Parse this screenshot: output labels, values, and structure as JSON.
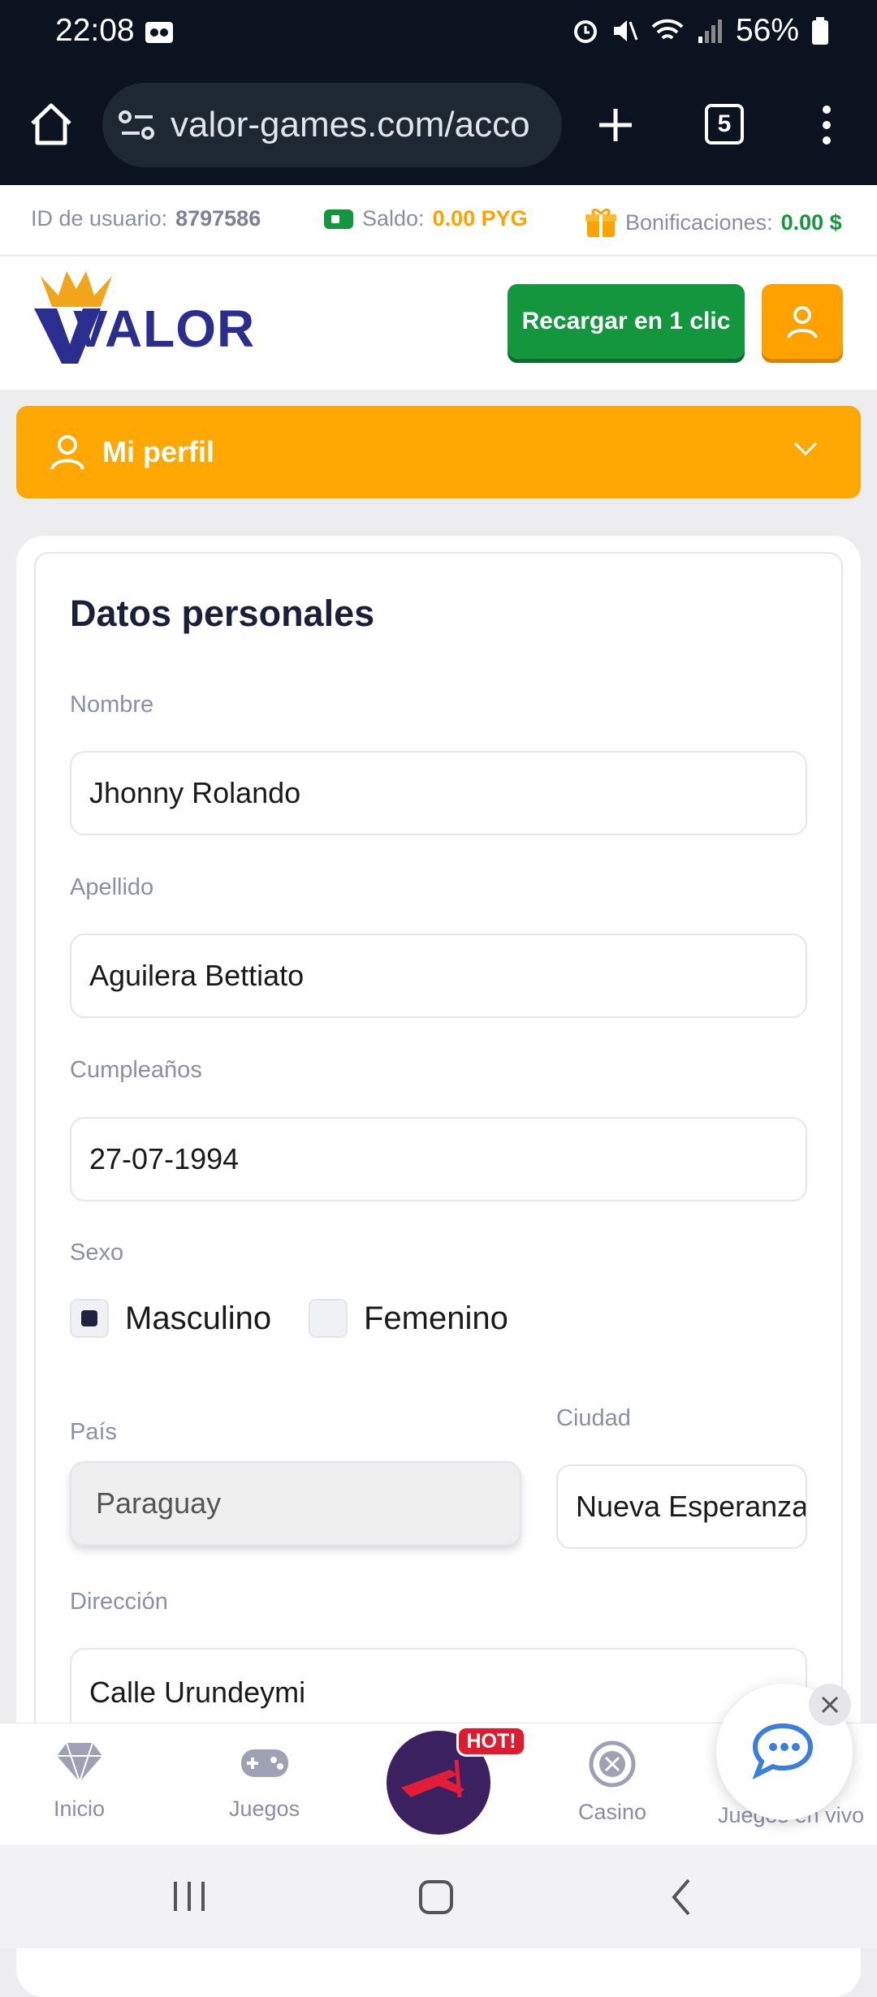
{
  "status_bar": {
    "time": "22:08",
    "battery": "56%"
  },
  "browser": {
    "url": "valor-games.com/acco",
    "tab_count": "5"
  },
  "user_bar": {
    "id_label": "ID de usuario:",
    "id_value": "8797586",
    "balance_label": "Saldo:",
    "balance_value": "0.00 PYG",
    "bonus_label": "Bonificaciones:",
    "bonus_value": "0.00 $"
  },
  "header": {
    "logo_text": "VALOR",
    "recharge_label": "Recargar en 1 clic"
  },
  "profile_menu": {
    "label": "Mi perfil"
  },
  "form": {
    "title": "Datos personales",
    "nombre_label": "Nombre",
    "nombre_value": "Jhonny Rolando",
    "apellido_label": "Apellido",
    "apellido_value": "Aguilera Bettiato",
    "birthday_label": "Cumpleaños",
    "birthday_value": "27-07-1994",
    "sexo_label": "Sexo",
    "masculino_label": "Masculino",
    "femenino_label": "Femenino",
    "pais_label": "País",
    "pais_value": "Paraguay",
    "ciudad_label": "Ciudad",
    "ciudad_value": "Nueva Esperanza",
    "direccion_label": "Dirección",
    "direccion_value": "Calle Urundeymi"
  },
  "bottom_nav": {
    "inicio": "Inicio",
    "juegos": "Juegos",
    "hot_badge": "HOT!",
    "casino": "Casino",
    "vivo": "Juegos en vivo"
  },
  "colors": {
    "brand_orange": "#ffa703",
    "brand_green": "#14963e",
    "brand_navy": "#2b2d8f"
  }
}
